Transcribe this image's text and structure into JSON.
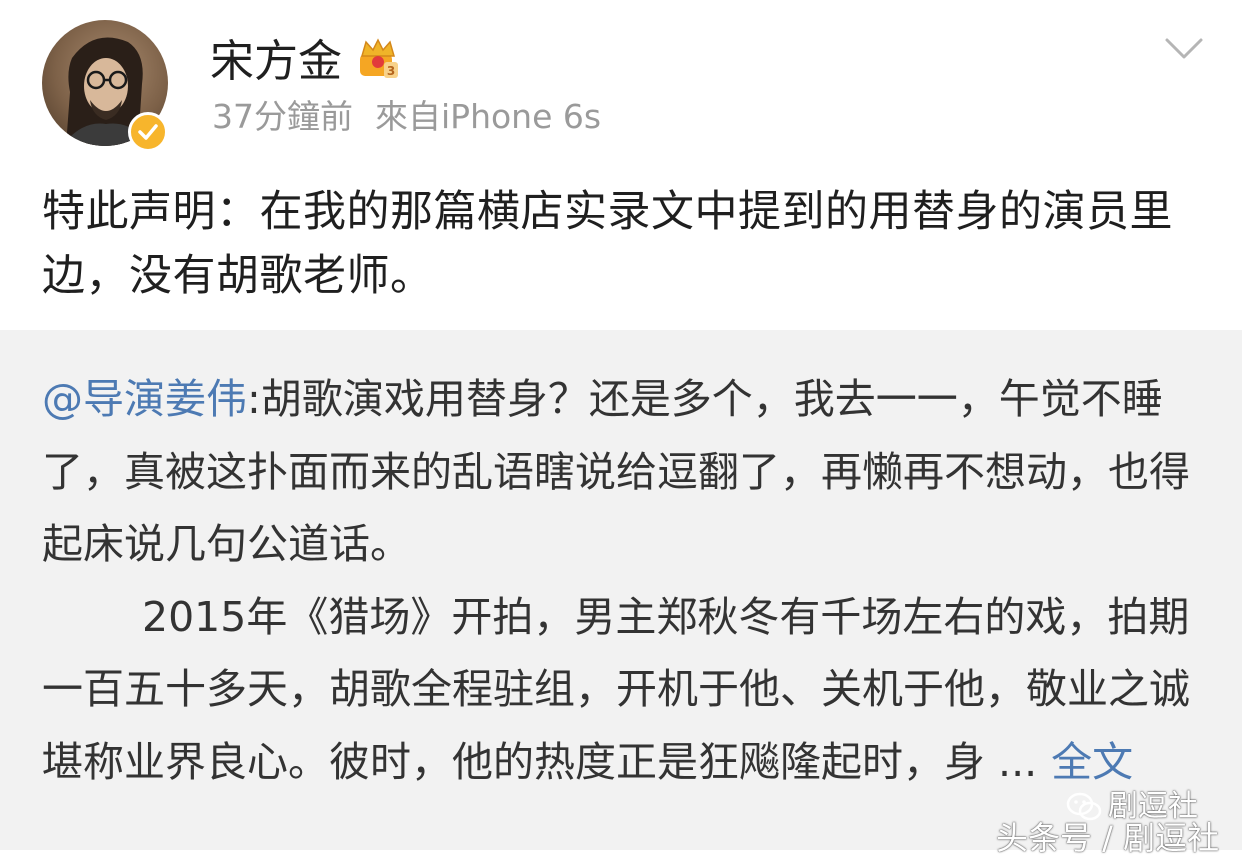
{
  "header": {
    "username": "宋方金",
    "time": "37分鐘前",
    "source": "來自iPhone 6s",
    "avatar_icon": "avatar-photo",
    "verified_icon": "verified-check-icon",
    "crown_icon": "member-crown-icon",
    "menu_icon": "chevron-down-icon"
  },
  "post": {
    "text": "特此声明：在我的那篇横店实录文中提到的用替身的演员里边，没有胡歌老师。"
  },
  "repost": {
    "mention": "@导演姜伟",
    "text_part1": ":胡歌演戏用替身？还是多个，我去一一，午觉不睡了，真被这扑面而来的乱语瞎说给逗翻了，再懒再不想动，也得起床说几句公道话。",
    "text_part2": "2015年《猎场》开拍，男主郑秋冬有千场左右的戏，拍期一百五十多天，胡歌全程驻组，开机于他、关机于他，敬业之诚堪称业界良心。彼时，他的热度正是狂飚隆起时，身 ...",
    "more_label": "全文"
  },
  "watermark": {
    "line1": "剧逗社",
    "line2": "头条号 / 剧逗社"
  },
  "colors": {
    "link": "#4d7ab3",
    "meta": "#9a9a9a",
    "repost_bg": "#f2f2f2",
    "badge": "#f7b52c"
  }
}
